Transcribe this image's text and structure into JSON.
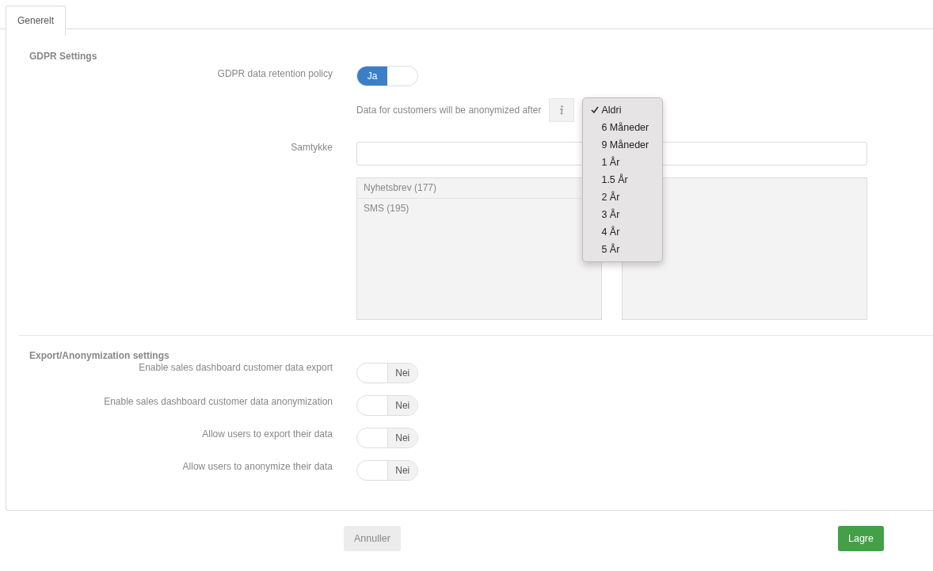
{
  "tabs": [
    {
      "label": "Generelt",
      "selected": true
    }
  ],
  "gdpr": {
    "title": "GDPR Settings",
    "retention": {
      "label": "GDPR data retention policy",
      "on": true,
      "text": "Ja"
    },
    "anonymize": {
      "label": "Data for customers will be anonymized after",
      "menu": [
        {
          "label": "Aldri",
          "selected": true
        },
        {
          "label": "6 Måneder",
          "selected": false
        },
        {
          "label": "9 Måneder",
          "selected": false
        },
        {
          "label": "1 År",
          "selected": false
        },
        {
          "label": "1.5 År",
          "selected": false
        },
        {
          "label": "2 År",
          "selected": false
        },
        {
          "label": "3 År",
          "selected": false
        },
        {
          "label": "4 År",
          "selected": false
        },
        {
          "label": "5 År",
          "selected": false
        }
      ]
    },
    "consent": {
      "label": "Samtykke",
      "available": [
        "Nyhetsbrev (177)",
        "SMS (195)"
      ]
    }
  },
  "export": {
    "title": "Export/Anonymization settings",
    "settings": [
      {
        "label": "Enable sales dashboard customer data export",
        "on": false,
        "text": "Nei"
      },
      {
        "label": "Enable sales dashboard customer data anonymization",
        "on": false,
        "text": "Nei"
      },
      {
        "label": "Allow users to export their data",
        "on": false,
        "text": "Nei"
      },
      {
        "label": "Allow users to anonymize their data",
        "on": false,
        "text": "Nei"
      }
    ]
  },
  "buttons": [
    {
      "label": "Annuller",
      "kind": "secondary"
    },
    {
      "label": "Lagre",
      "kind": "primary"
    }
  ]
}
